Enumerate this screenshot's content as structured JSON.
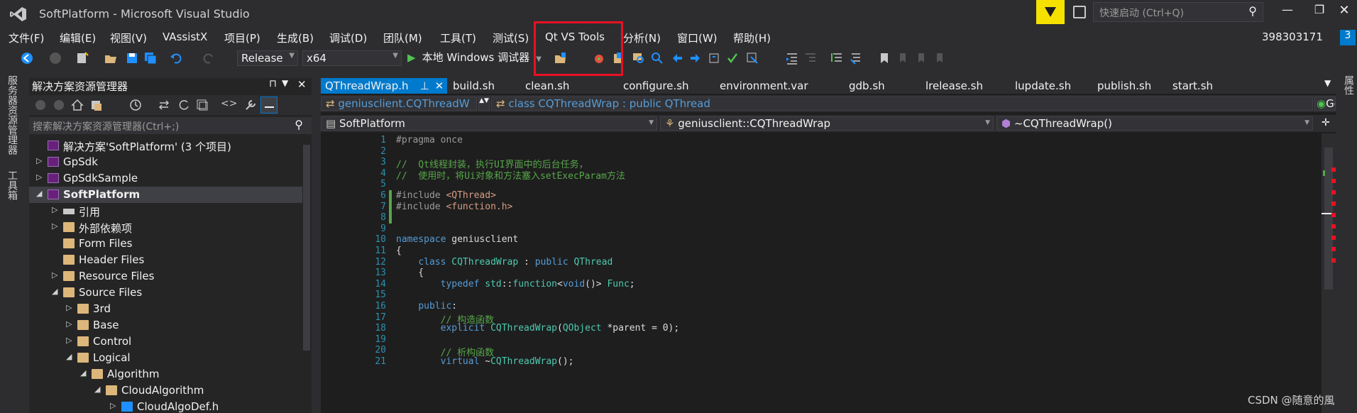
{
  "window": {
    "title": "SoftPlatform - Microsoft Visual Studio",
    "quick_launch": "快速启动 (Ctrl+Q)",
    "user": "398303171",
    "notif": "3"
  },
  "menu": [
    "文件(F)",
    "编辑(E)",
    "视图(V)",
    "VAssistX",
    "项目(P)",
    "生成(B)",
    "调试(D)",
    "团队(M)",
    "工具(T)",
    "测试(S)",
    "Qt VS Tools",
    "分析(N)",
    "窗口(W)",
    "帮助(H)"
  ],
  "toolbar": {
    "config": "Release",
    "platform": "x64",
    "debugger": "本地 Windows 调试器"
  },
  "left_tabs": [
    "服务器资源管理器",
    "工具箱"
  ],
  "right_tabs": [
    "属性"
  ],
  "solution_explorer": {
    "title": "解决方案资源管理器",
    "search_placeholder": "搜索解决方案资源管理器(Ctrl+;)",
    "items": [
      {
        "label": "解决方案'SoftPlatform' (3 个项目)",
        "level": 0,
        "exp": "",
        "icon": "solution"
      },
      {
        "label": "GpSdk",
        "level": 0,
        "exp": "▷",
        "icon": "project"
      },
      {
        "label": "GpSdkSample",
        "level": 0,
        "exp": "▷",
        "icon": "project"
      },
      {
        "label": "SoftPlatform",
        "level": 0,
        "exp": "◢",
        "icon": "project"
      },
      {
        "label": "引用",
        "level": 1,
        "exp": "▷",
        "icon": "ref"
      },
      {
        "label": "外部依赖项",
        "level": 1,
        "exp": "▷",
        "icon": "folder"
      },
      {
        "label": "Form Files",
        "level": 1,
        "exp": "",
        "icon": "folder"
      },
      {
        "label": "Header Files",
        "level": 1,
        "exp": "",
        "icon": "folder"
      },
      {
        "label": "Resource Files",
        "level": 1,
        "exp": "▷",
        "icon": "folder"
      },
      {
        "label": "Source Files",
        "level": 1,
        "exp": "◢",
        "icon": "folder"
      },
      {
        "label": "3rd",
        "level": 2,
        "exp": "▷",
        "icon": "folder"
      },
      {
        "label": "Base",
        "level": 2,
        "exp": "▷",
        "icon": "folder"
      },
      {
        "label": "Control",
        "level": 2,
        "exp": "▷",
        "icon": "folder"
      },
      {
        "label": "Logical",
        "level": 2,
        "exp": "◢",
        "icon": "folder"
      },
      {
        "label": "Algorithm",
        "level": 3,
        "exp": "◢",
        "icon": "folder"
      },
      {
        "label": "CloudAlgorithm",
        "level": 4,
        "exp": "◢",
        "icon": "folder"
      },
      {
        "label": "CloudAlgoDef.h",
        "level": 5,
        "exp": "▷",
        "icon": "file"
      }
    ]
  },
  "editor": {
    "tabs": [
      "QThreadWrap.h",
      "build.sh",
      "clean.sh",
      "configure.sh",
      "environment.var",
      "gdb.sh",
      "lrelease.sh",
      "lupdate.sh",
      "publish.sh",
      "start.sh"
    ],
    "nav_top_left": "geniusclient.CQThreadW",
    "nav_top_mid": "class CQThreadWrap : public QThread",
    "nav_top_go": "Go",
    "nav_project": "SoftPlatform",
    "nav_scope": "geniusclient::CQThreadWrap",
    "nav_member": "~CQThreadWrap()",
    "lines": [
      {
        "n": "1",
        "t": "#pragma once"
      },
      {
        "n": "2",
        "t": ""
      },
      {
        "n": "3",
        "t": "//  Qt线程封装，执行UI界面中的后台任务，"
      },
      {
        "n": "4",
        "t": "//  使用时，将Ui对象和方法塞入setExecParam方法"
      },
      {
        "n": "5",
        "t": ""
      },
      {
        "n": "6",
        "t": "#include <QThread>"
      },
      {
        "n": "7",
        "t": "#include <function.h>"
      },
      {
        "n": "8",
        "t": ""
      },
      {
        "n": "9",
        "t": ""
      },
      {
        "n": "10",
        "t": "namespace geniusclient"
      },
      {
        "n": "11",
        "t": "{"
      },
      {
        "n": "12",
        "t": "    class CQThreadWrap : public QThread"
      },
      {
        "n": "13",
        "t": "    {"
      },
      {
        "n": "14",
        "t": "        typedef std::function<void()> Func;"
      },
      {
        "n": "15",
        "t": ""
      },
      {
        "n": "16",
        "t": "    public:"
      },
      {
        "n": "17",
        "t": "        // 构造函数"
      },
      {
        "n": "18",
        "t": "        explicit CQThreadWrap(QObject *parent = 0);"
      },
      {
        "n": "19",
        "t": ""
      },
      {
        "n": "20",
        "t": "        // 析构函数"
      },
      {
        "n": "21",
        "t": "        virtual ~CQThreadWrap();"
      }
    ]
  },
  "watermark": "CSDN @随意的風",
  "colors": {
    "accent": "#007acc",
    "highlight_box": "#e81123",
    "bg": "#2d2d30",
    "editor_bg": "#1e1e1e"
  }
}
